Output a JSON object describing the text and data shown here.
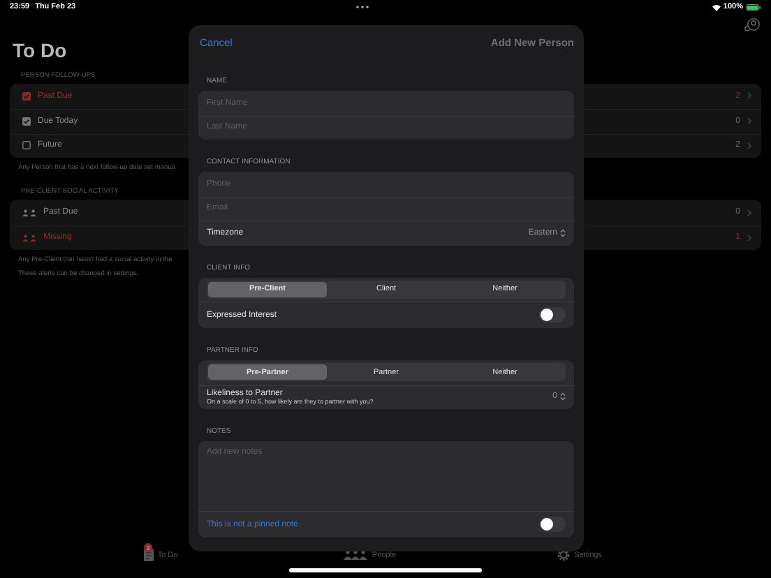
{
  "status_bar": {
    "time": "23:59",
    "date": "Thu Feb 23",
    "battery": "100%"
  },
  "page": {
    "title": "To Do",
    "sections": [
      {
        "header": "PERSON FOLLOW-UPS",
        "rows": [
          {
            "kind": "checkbox",
            "label": "Past Due",
            "count": "2",
            "checked": true,
            "alert": true
          },
          {
            "kind": "checkbox",
            "label": "Due Today",
            "count": "0",
            "checked": true,
            "alert": false
          },
          {
            "kind": "checkbox",
            "label": "Future",
            "count": "2",
            "checked": false,
            "alert": false
          }
        ],
        "footer": [
          "Any Person that has a next follow-up date set manua"
        ]
      },
      {
        "header": "PRE-CLIENT SOCIAL ACTIVITY",
        "rows": [
          {
            "kind": "people",
            "label": "Past Due",
            "count": "0",
            "alert": false
          },
          {
            "kind": "people",
            "label": "Missing",
            "count": "1",
            "alert": true
          }
        ],
        "footer": [
          "Any Pre-Client that hasn't had a social activity in the",
          "These alerts can be changed in settings."
        ]
      }
    ]
  },
  "sheet": {
    "cancel": "Cancel",
    "title": "Add New Person",
    "sections": [
      {
        "header": "NAME",
        "rows": [
          {
            "kind": "field",
            "placeholder": "First Name"
          },
          {
            "kind": "field",
            "placeholder": "Last Name"
          }
        ]
      },
      {
        "header": "CONTACT INFORMATION",
        "rows": [
          {
            "kind": "field",
            "placeholder": "Phone"
          },
          {
            "kind": "field",
            "placeholder": "Email"
          },
          {
            "kind": "picker",
            "label": "Timezone",
            "value": "Eastern"
          }
        ]
      },
      {
        "header": "CLIENT INFO",
        "rows": [
          {
            "kind": "segments",
            "options": [
              {
                "label": "Pre-Client",
                "selected": true
              },
              {
                "label": "Client",
                "selected": false
              },
              {
                "label": "Neither",
                "selected": false
              }
            ]
          },
          {
            "kind": "toggle",
            "label": "Expressed Interest",
            "on": false,
            "link": false
          }
        ]
      },
      {
        "header": "PARTNER INFO",
        "rows": [
          {
            "kind": "segments",
            "options": [
              {
                "label": "Pre-Partner",
                "selected": true
              },
              {
                "label": "Partner",
                "selected": false
              },
              {
                "label": "Neither",
                "selected": false
              }
            ]
          },
          {
            "kind": "stepper",
            "label": "Likeliness to Partner",
            "subtitle": "On a scale of 0 to 5, how likely are they to partner with you?",
            "value": "0"
          }
        ]
      },
      {
        "header": "NOTES",
        "rows": [
          {
            "kind": "notes",
            "placeholder": "Add new notes"
          },
          {
            "kind": "toggle",
            "label": "This is not a pinned note",
            "on": false,
            "link": true
          }
        ]
      }
    ]
  },
  "tab_bar": [
    {
      "label": "To Do",
      "badge": "3"
    },
    {
      "label": "People"
    },
    {
      "label": "Settings"
    }
  ]
}
